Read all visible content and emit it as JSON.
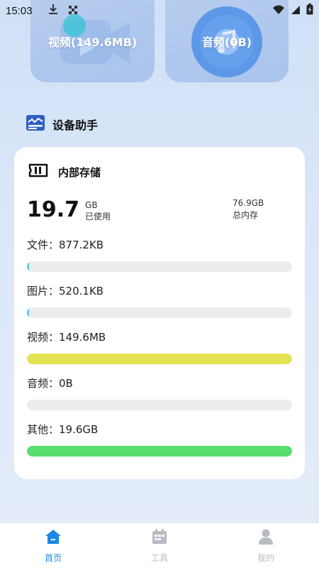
{
  "status_bar": {
    "time": "15:03",
    "left_icons": [
      "download-icon",
      "app-icon"
    ],
    "right_icons": [
      "wifi-icon",
      "cellular-signal-icon",
      "battery-icon"
    ]
  },
  "media_cards": {
    "video": {
      "label": "视频(149.6MB)",
      "icon": "video-camera-icon"
    },
    "audio": {
      "label": "音频(0B)",
      "icon": "music-disc-icon"
    }
  },
  "section": {
    "title": "设备助手",
    "icon": "device-assistant-icon"
  },
  "storage": {
    "title": "内部存储",
    "icon": "storage-card-icon",
    "used_value": "19.7",
    "used_unit": "GB",
    "used_label": "已使用",
    "total_value": "76.9GB",
    "total_label": "总内存",
    "items": [
      {
        "label": "文件：877.2KB",
        "fraction": 0.008,
        "color": "#5bc8e4"
      },
      {
        "label": "图片：520.1KB",
        "fraction": 0.005,
        "color": "#5bc8e4"
      },
      {
        "label": "视频：149.6MB",
        "fraction": 1.0,
        "color": "#e3e355"
      },
      {
        "label": "音频：0B",
        "fraction": 0.0,
        "color": "#e3e355"
      },
      {
        "label": "其他：19.6GB",
        "fraction": 1.0,
        "color": "#58dd6f"
      }
    ]
  },
  "colors": {
    "accent": "#1e88e5",
    "nav_inactive": "#b8bcc4",
    "card_background": "#ffffff",
    "media_card": "#b0c8ed"
  },
  "bottom_nav": [
    {
      "label": "首页",
      "icon": "home-icon",
      "active": true
    },
    {
      "label": "工具",
      "icon": "calendar-tools-icon",
      "active": false
    },
    {
      "label": "我的",
      "icon": "user-icon",
      "active": false
    }
  ]
}
